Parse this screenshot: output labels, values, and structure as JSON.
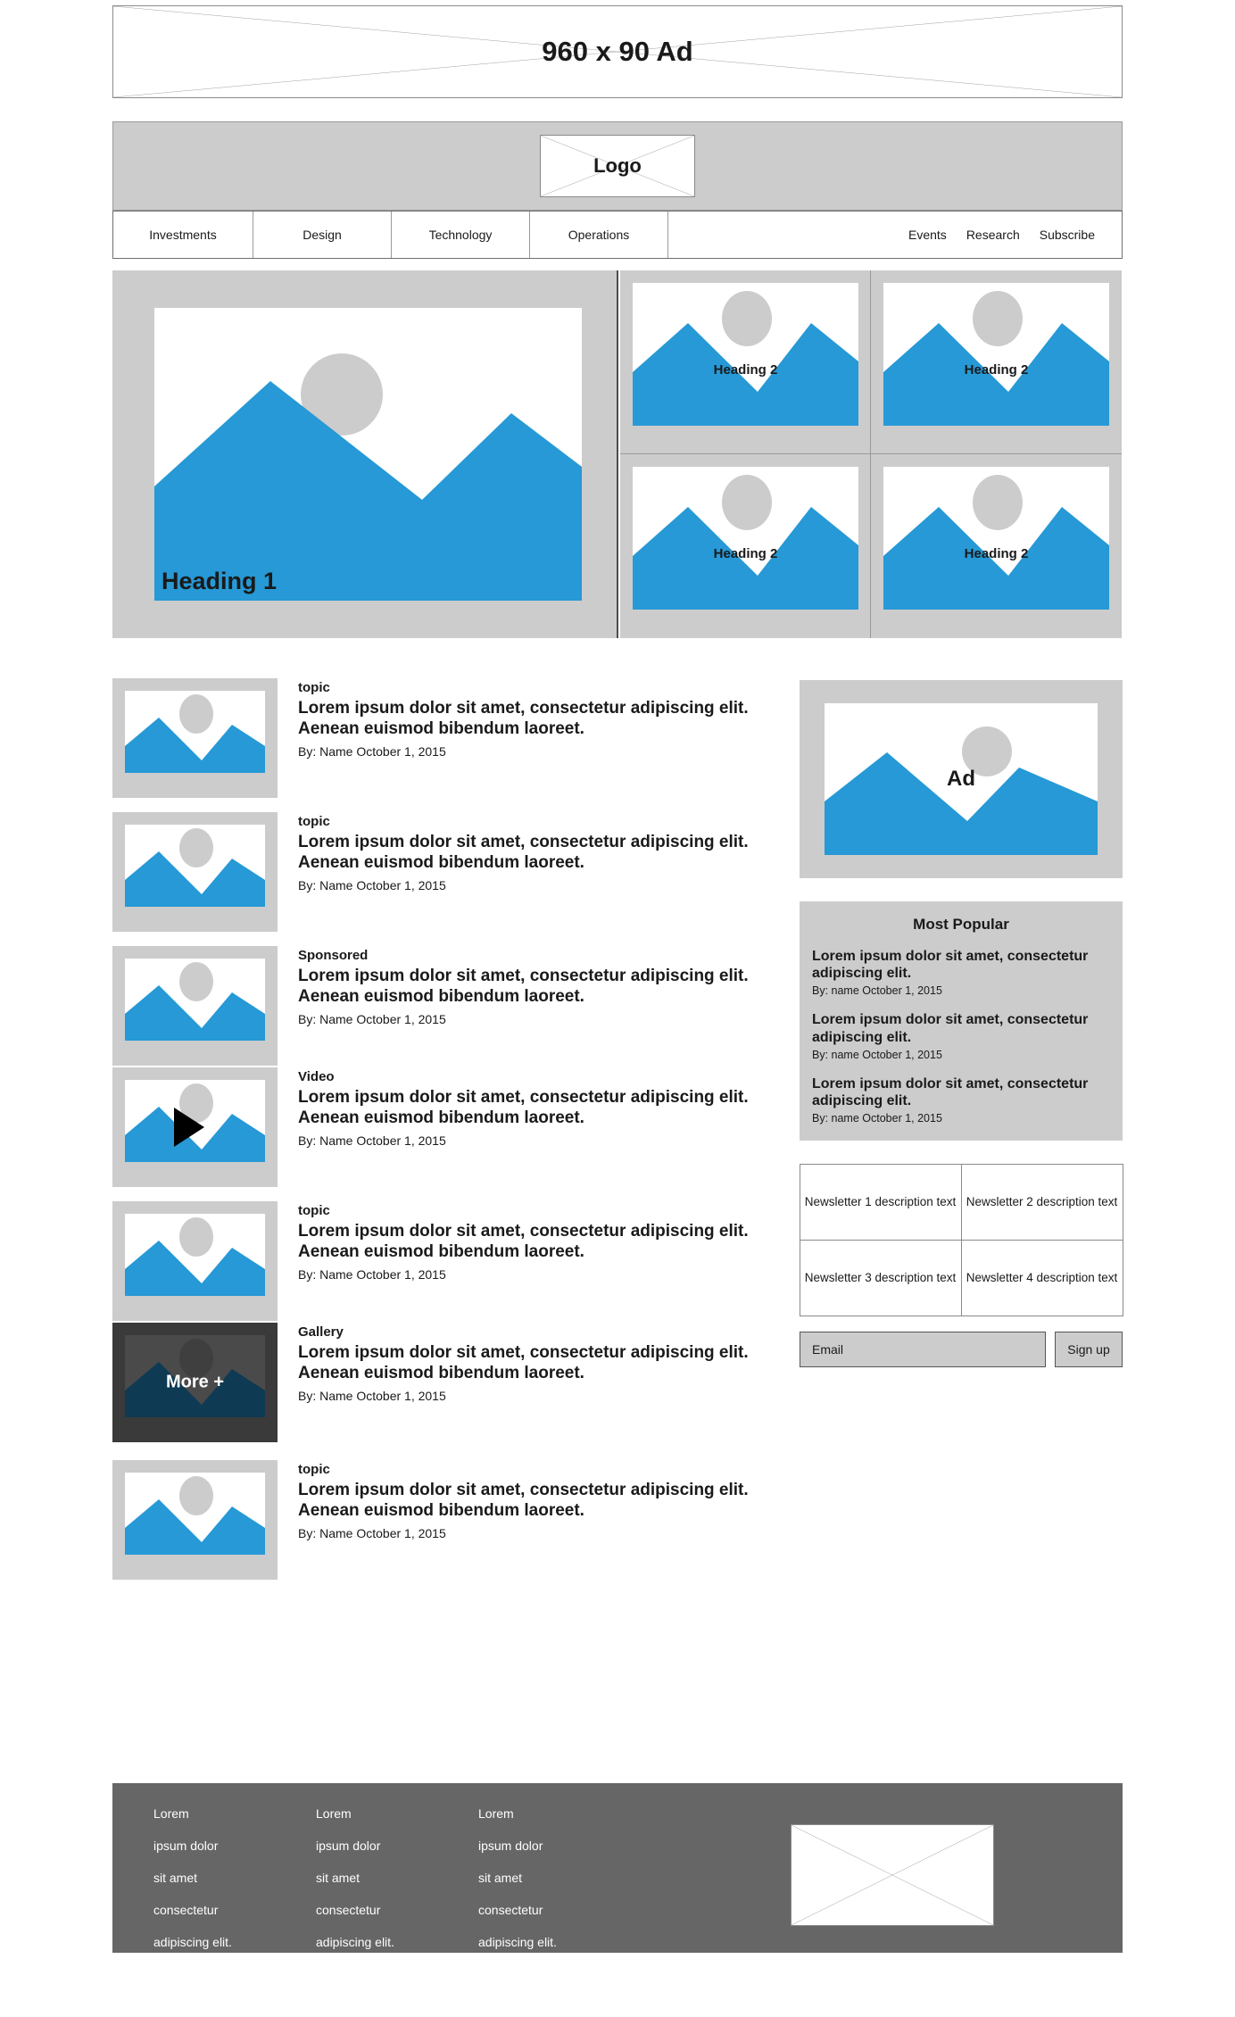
{
  "top_ad": {
    "label": "960 x 90 Ad"
  },
  "header": {
    "logo_label": "Logo"
  },
  "nav": {
    "primary": [
      "Investments",
      "Design",
      "Technology",
      "Operations"
    ],
    "secondary": [
      "Events",
      "Research",
      "Subscribe"
    ]
  },
  "hero": {
    "main_heading": "Heading 1",
    "cards": [
      {
        "heading": "Heading 2"
      },
      {
        "heading": "Heading 2"
      },
      {
        "heading": "Heading 2"
      },
      {
        "heading": "Heading 2"
      }
    ]
  },
  "articles": [
    {
      "topic": "topic",
      "title": "Lorem ipsum dolor sit amet, consectetur adipiscing elit. Aenean euismod bibendum laoreet.",
      "byline": "By: Name October 1, 2015",
      "thumb_type": "image"
    },
    {
      "topic": "topic",
      "title": "Lorem ipsum dolor sit amet, consectetur adipiscing elit. Aenean euismod bibendum laoreet.",
      "byline": "By: Name October 1, 2015",
      "thumb_type": "image"
    },
    {
      "topic": "Sponsored",
      "title": "Lorem ipsum dolor sit amet, consectetur adipiscing elit. Aenean euismod bibendum laoreet.",
      "byline": "By: Name October 1, 2015",
      "thumb_type": "image"
    },
    {
      "topic": "Video",
      "title": "Lorem ipsum dolor sit amet, consectetur adipiscing elit. Aenean euismod bibendum laoreet.",
      "byline": "By: Name October 1, 2015",
      "thumb_type": "video"
    },
    {
      "topic": "topic",
      "title": "Lorem ipsum dolor sit amet, consectetur adipiscing elit. Aenean euismod bibendum laoreet.",
      "byline": "By: Name October 1, 2015",
      "thumb_type": "image"
    },
    {
      "topic": "Gallery",
      "title": "Lorem ipsum dolor sit amet, consectetur adipiscing elit. Aenean euismod bibendum laoreet.",
      "byline": "By: Name October 1, 2015",
      "thumb_type": "gallery",
      "thumb_overlay_label": "More +"
    },
    {
      "topic": "topic",
      "title": "Lorem ipsum dolor sit amet, consectetur adipiscing elit. Aenean euismod bibendum laoreet.",
      "byline": "By: Name October 1, 2015",
      "thumb_type": "image"
    }
  ],
  "sidebar": {
    "ad": {
      "label": "Ad"
    },
    "most_popular": {
      "title": "Most Popular",
      "items": [
        {
          "headline": "Lorem ipsum dolor sit amet, consectetur adipiscing elit.",
          "byline": "By: name October 1, 2015"
        },
        {
          "headline": "Lorem ipsum dolor sit amet, consectetur adipiscing elit.",
          "byline": "By: name October 1, 2015"
        },
        {
          "headline": "Lorem ipsum dolor sit amet, consectetur adipiscing elit.",
          "byline": "By: name October 1, 2015"
        }
      ]
    },
    "newsletters": [
      "Newsletter 1 description text",
      "Newsletter 2 description text",
      "Newsletter 3 description text",
      "Newsletter 4 description text"
    ],
    "signup": {
      "email_placeholder": "Email",
      "button_label": "Sign up"
    }
  },
  "footer": {
    "columns": [
      [
        "Lorem",
        "ipsum dolor",
        "sit amet",
        "consectetur",
        "adipiscing elit."
      ],
      [
        "Lorem",
        "ipsum dolor",
        "sit amet",
        "consectetur",
        "adipiscing elit."
      ],
      [
        "Lorem",
        "ipsum dolor",
        "sit amet",
        "consectetur",
        "adipiscing elit."
      ]
    ]
  },
  "colors": {
    "accent_blue": "#2699d6",
    "placeholder_gray": "#cccccc",
    "footer_gray": "#666666",
    "dark_thumb": "#3a3a3a"
  }
}
